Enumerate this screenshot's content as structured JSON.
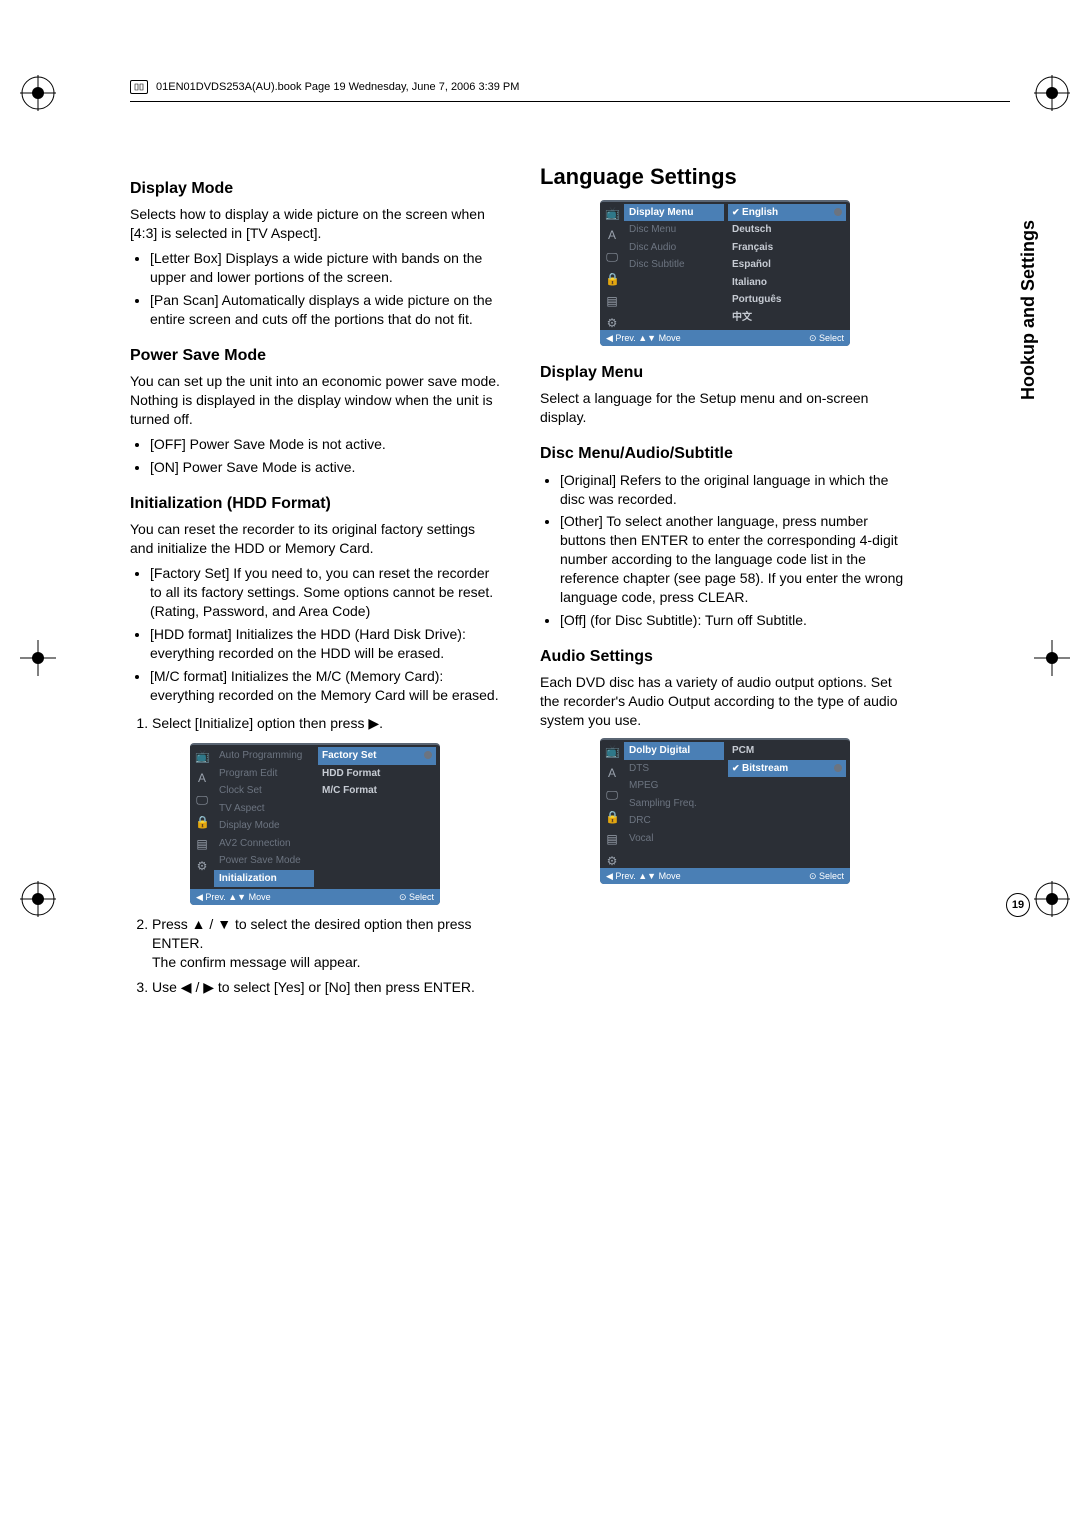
{
  "header": {
    "text": "01EN01DVDS253A(AU).book  Page 19  Wednesday, June 7, 2006  3:39 PM"
  },
  "sideTab": "Hookup and Settings",
  "pageNumber": "19",
  "left": {
    "h_displayMode": "Display Mode",
    "p_displayMode_intro": "Selects how to display a wide picture on the screen when [4:3] is selected in [TV Aspect].",
    "li_letterBox": "[Letter Box] Displays a wide picture with bands on the upper and lower portions of the screen.",
    "li_panScan": "[Pan Scan] Automatically displays a wide picture on the entire screen and cuts off the portions that do not fit.",
    "h_powerSave": "Power Save Mode",
    "p_powerSave_intro": "You can set up the unit into an economic power save mode. Nothing is displayed in the display window when the unit is turned off.",
    "li_ps_off": "[OFF] Power Save Mode is not active.",
    "li_ps_on": "[ON] Power Save Mode is active.",
    "h_init": "Initialization (HDD Format)",
    "p_init_intro": "You can reset the recorder to its original factory settings and initialize the HDD or Memory Card.",
    "li_factorySet": "[Factory Set] If you need to, you can reset the recorder to all its factory settings. Some options cannot be reset. (Rating, Password, and Area Code)",
    "li_hddFormat": "[HDD format] Initializes the HDD (Hard Disk Drive): everything recorded on the HDD will be erased.",
    "li_mcFormat": "[M/C format] Initializes the M/C (Memory Card): everything recorded on the Memory Card will be erased.",
    "ol1": "Select [Initialize] option then press ▶.",
    "ol2": "Press ▲ / ▼ to select the desired option then press ENTER.\nThe confirm message will appear.",
    "ol3": "Use ◀ / ▶ to select [Yes] or [No] then press ENTER."
  },
  "right": {
    "h_lang": "Language Settings",
    "h_displayMenu": "Display Menu",
    "p_displayMenu": "Select a language for the Setup menu and on-screen display.",
    "h_discMenu": "Disc Menu/Audio/Subtitle",
    "li_original": "[Original] Refers to the original language in which the disc was recorded.",
    "li_other": "[Other] To select another language, press number buttons then ENTER to enter the corresponding 4-digit number according to the language code list in the reference chapter (see page 58). If you enter the wrong language code, press CLEAR.",
    "li_off": "[Off] (for Disc Subtitle): Turn off Subtitle.",
    "h_audio": "Audio Settings",
    "p_audio": "Each DVD disc has a variety of audio output options. Set the recorder's Audio Output according to the type of audio system you use."
  },
  "osd1": {
    "mid": [
      "Auto Programming",
      "Program Edit",
      "Clock Set",
      "TV Aspect",
      "Display Mode",
      "AV2 Connection",
      "Power Save Mode",
      "Initialization"
    ],
    "midSelIndex": 7,
    "right": [
      "Factory Set",
      "HDD Format",
      "M/C Format"
    ],
    "rightSelIndex": 0,
    "footerLeft": "◀ Prev.  ▲▼ Move",
    "footerRight": "⊙ Select"
  },
  "osd2": {
    "mid": [
      "Display Menu",
      "Disc Menu",
      "Disc Audio",
      "Disc Subtitle"
    ],
    "midSelIndex": 0,
    "right": [
      "English",
      "Deutsch",
      "Français",
      "Español",
      "Italiano",
      "Português",
      "中文"
    ],
    "rightSelIndex": 0,
    "footerLeft": "◀ Prev.  ▲▼ Move",
    "footerRight": "⊙ Select"
  },
  "osd3": {
    "mid": [
      "Dolby Digital",
      "DTS",
      "MPEG",
      "Sampling Freq.",
      "DRC",
      "Vocal"
    ],
    "midSelIndex": 0,
    "right": [
      "PCM",
      "Bitstream"
    ],
    "rightSelIndex": 1,
    "footerLeft": "◀ Prev.  ▲▼ Move",
    "footerRight": "⊙ Select"
  }
}
